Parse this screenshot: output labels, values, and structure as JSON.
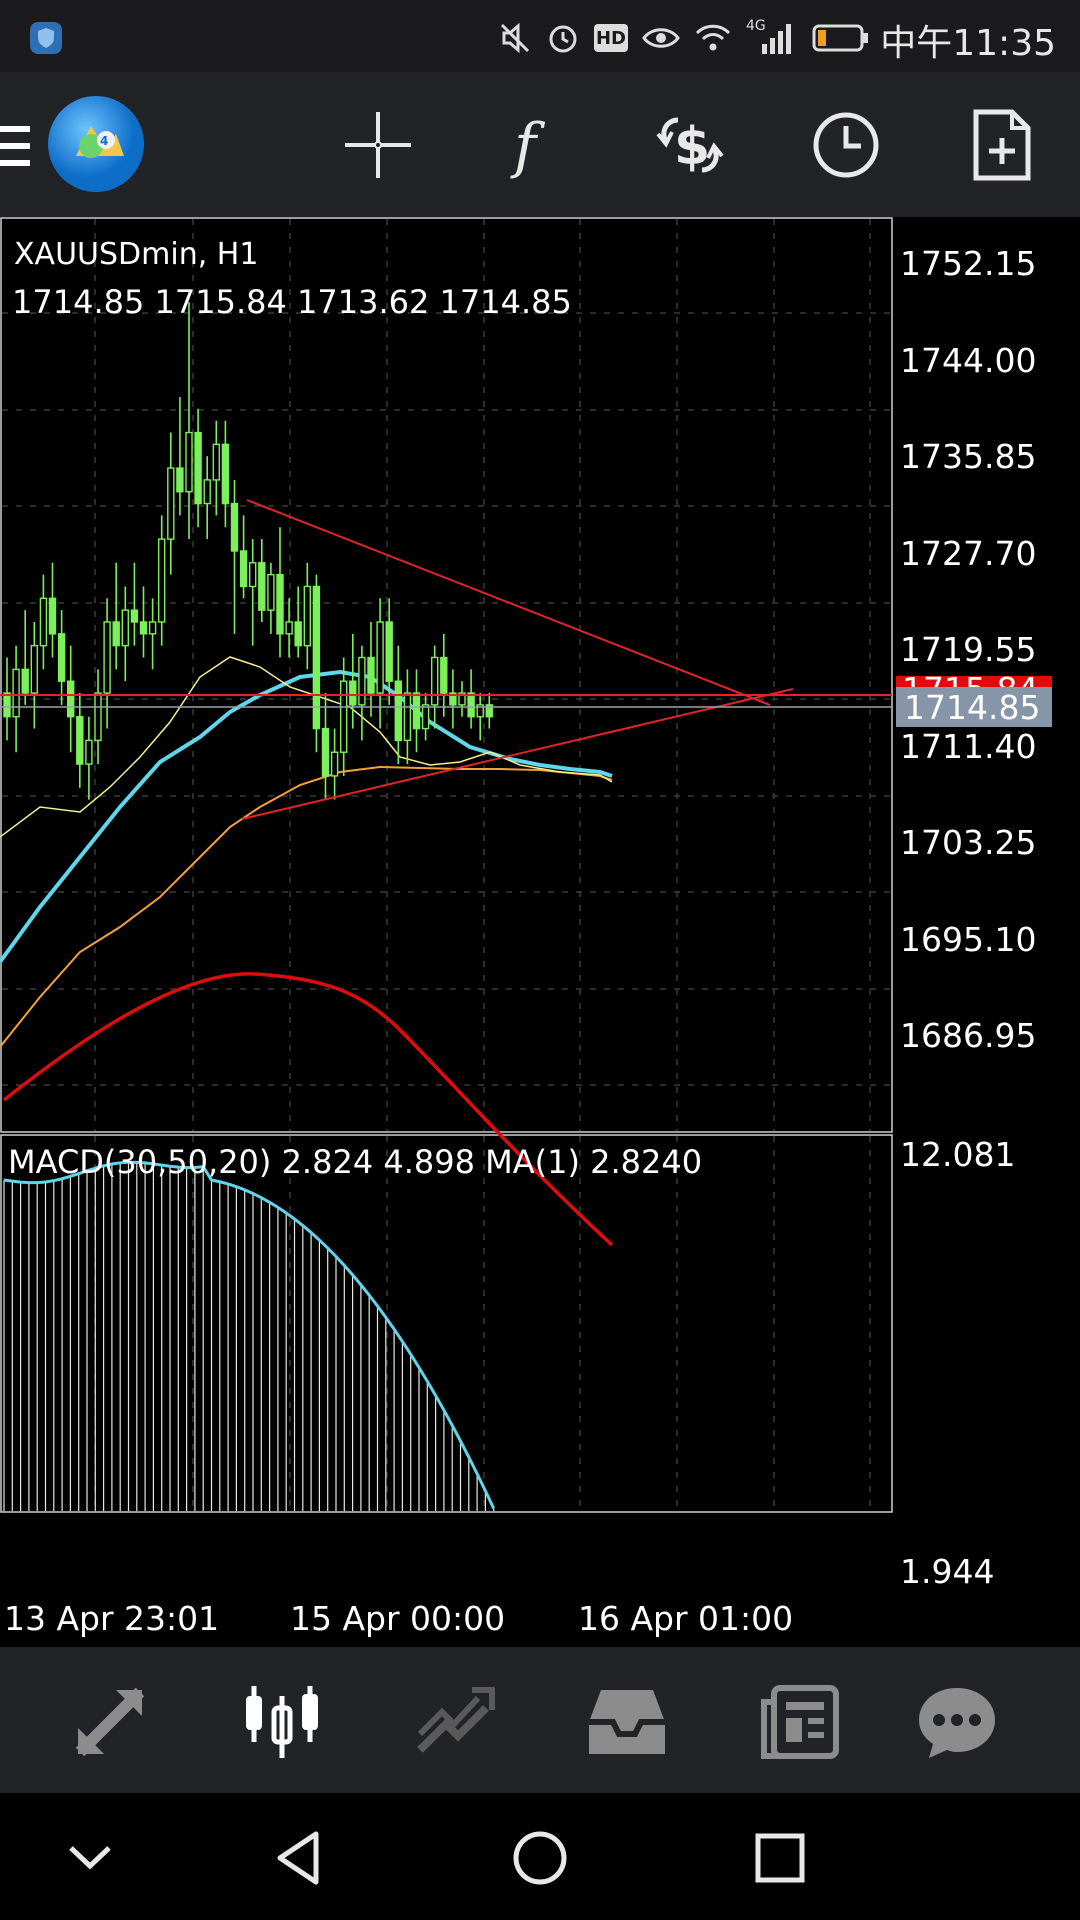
{
  "status_bar": {
    "time": "中午11:35",
    "icons": [
      "shield-icon",
      "mute-icon",
      "alarm-icon",
      "hd-icon",
      "eye-icon",
      "wifi-icon",
      "signal-4g-icon",
      "battery-icon"
    ],
    "badge_hd": "HD",
    "badge_4g": "4G"
  },
  "toolbar": {
    "icons": [
      "menu-icon",
      "metatrader-logo",
      "crosshair-icon",
      "function-icon",
      "trade-icon",
      "clock-icon",
      "new-document-icon"
    ]
  },
  "chart": {
    "symbol_label": "XAUUSDmin, H1",
    "ohlc_label": "1714.85 1715.84 1713.62 1714.85",
    "macd_label": "MACD(30,50,20) 2.824 4.898 MA(1) 2.8240",
    "price_ticks": [
      "1752.15",
      "1744.00",
      "1735.85",
      "1727.70",
      "1719.55",
      "1711.40",
      "1703.25",
      "1695.10",
      "1686.95"
    ],
    "current_price": "1714.85",
    "hidden_price_red": "1715.84",
    "macd_ticks": [
      "12.081",
      "1.944"
    ],
    "date_ticks": [
      "13 Apr 23:01",
      "15 Apr 00:00",
      "16 Apr 01:00"
    ],
    "colors": {
      "bull": "#7cf05a",
      "bear": "#7cf05a",
      "ma_fast": "#f5f08a",
      "ma_mid": "#5fd6ea",
      "ma_slow": "#f5a13a",
      "trend": "#e0242a",
      "signal": "#e00b0b",
      "macd_line": "#5fd6ea"
    }
  },
  "bottom_nav": {
    "icons": [
      "quotes-icon",
      "chart-icon",
      "trade-icon",
      "history-icon",
      "news-icon",
      "chat-icon"
    ],
    "active": "chart-icon"
  },
  "system_nav": {
    "icons": [
      "collapse-icon",
      "back-icon",
      "home-icon",
      "recents-icon"
    ]
  }
}
